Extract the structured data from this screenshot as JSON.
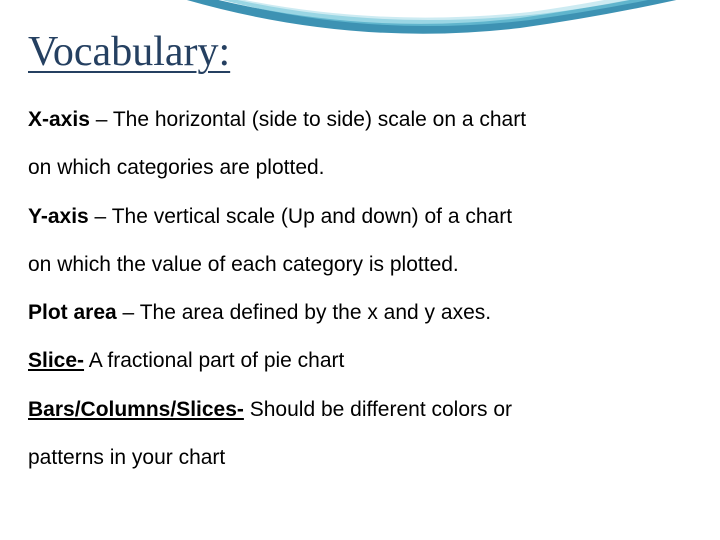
{
  "title": "Vocabulary:",
  "definitions": {
    "xaxis": {
      "term": "X-axis",
      "sep": " – ",
      "text1": "The horizontal (side to side) scale on a chart",
      "text2": "on which categories are plotted."
    },
    "yaxis": {
      "term": "Y-axis",
      "sep": " – ",
      "text1": "The vertical scale (Up and down) of a chart",
      "text2": "on which the value of each category is plotted."
    },
    "plotarea": {
      "term": "Plot area",
      "sep": " – ",
      "text": "The area defined by the x and y axes."
    },
    "slice": {
      "term": "Slice-",
      "sep": " ",
      "text": "A fractional part of pie chart"
    },
    "bars": {
      "term": "Bars/Columns/Slices-",
      "sep": " ",
      "text1": "Should be different colors or",
      "text2": "patterns in your chart"
    }
  }
}
